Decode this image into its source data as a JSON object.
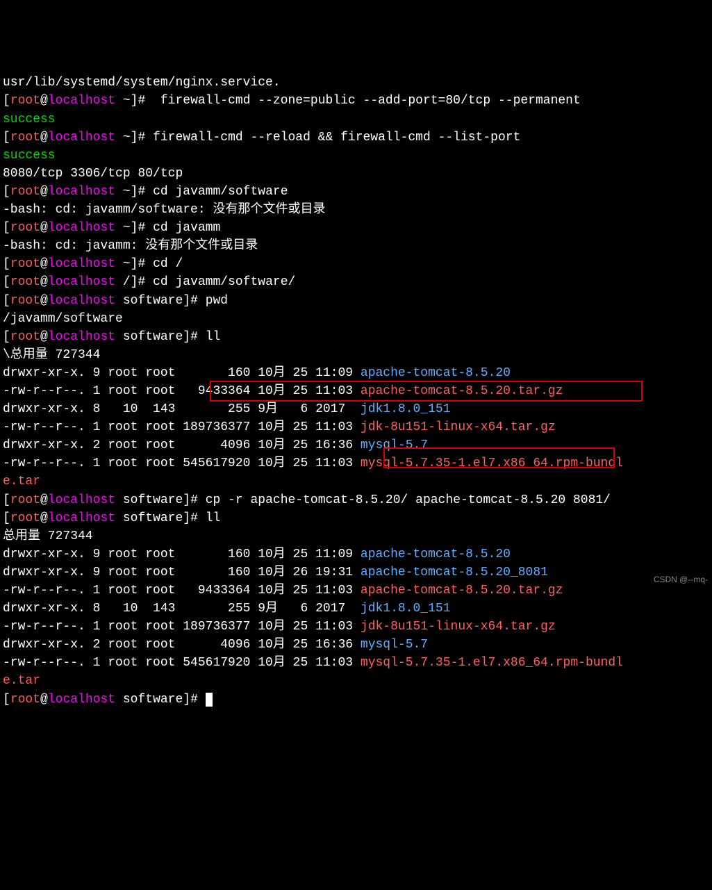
{
  "lines": [
    {
      "t": "usr/lib/systemd/system/nginx.service.",
      "c": "white"
    },
    {
      "prompt": true,
      "host": "localhost",
      "cwd": "~",
      "cmd": " firewall-cmd --zone=public --add-port=80/tcp --permanent"
    },
    {
      "t": "success",
      "c": "green"
    },
    {
      "prompt": true,
      "host": "localhost",
      "cwd": "~",
      "cmd": "firewall-cmd --reload && firewall-cmd --list-port"
    },
    {
      "t": "success",
      "c": "green"
    },
    {
      "t": "8080/tcp 3306/tcp 80/tcp",
      "c": "white"
    },
    {
      "prompt": true,
      "host": "localhost",
      "cwd": "~",
      "cmd": "cd javamm/software"
    },
    {
      "t": "-bash: cd: javamm/software: 没有那个文件或目录",
      "c": "white"
    },
    {
      "prompt": true,
      "host": "localhost",
      "cwd": "~",
      "cmd": "cd javamm"
    },
    {
      "t": "-bash: cd: javamm: 没有那个文件或目录",
      "c": "white"
    },
    {
      "prompt": true,
      "host": "localhost",
      "cwd": "~",
      "cmd": "cd /"
    },
    {
      "prompt": true,
      "host": "localhost",
      "cwd": "/",
      "cmd": "cd javamm/software/"
    },
    {
      "prompt": true,
      "host": "localhost",
      "cwd": "software",
      "cmd": "pwd"
    },
    {
      "t": "/javamm/software",
      "c": "white"
    },
    {
      "prompt": true,
      "host": "localhost",
      "cwd": "software",
      "cmd": "ll"
    },
    {
      "t": "\\总用量 727344",
      "c": "white"
    },
    {
      "ls": true,
      "perm": "drwxr-xr-x.",
      "n": "9",
      "o": "root",
      "g": "root",
      "size": "      160",
      "mon": "10月",
      "day": "25",
      "time": "11:09",
      "name": "apache-tomcat-8.5.20",
      "fc": "blue"
    },
    {
      "ls": true,
      "perm": "-rw-r--r--.",
      "n": "1",
      "o": "root",
      "g": "root",
      "size": "  9433364",
      "mon": "10月",
      "day": "25",
      "time": "11:03",
      "name": "apache-tomcat-8.5.20.tar.gz",
      "fc": "red"
    },
    {
      "ls": true,
      "perm": "drwxr-xr-x.",
      "n": "8",
      "o": "  10",
      "g": " 143",
      "size": "      255",
      "mon": "9月 ",
      "day": " 6",
      "time": "2017 ",
      "name": "jdk1.8.0_151",
      "fc": "blue"
    },
    {
      "ls": true,
      "perm": "-rw-r--r--.",
      "n": "1",
      "o": "root",
      "g": "root",
      "size": "189736377",
      "mon": "10月",
      "day": "25",
      "time": "11:03",
      "name": "jdk-8u151-linux-x64.tar.gz",
      "fc": "red"
    },
    {
      "ls": true,
      "perm": "drwxr-xr-x.",
      "n": "2",
      "o": "root",
      "g": "root",
      "size": "     4096",
      "mon": "10月",
      "day": "25",
      "time": "16:36",
      "name": "mysql-5.7",
      "fc": "blue"
    },
    {
      "ls": true,
      "perm": "-rw-r--r--.",
      "n": "1",
      "o": "root",
      "g": "root",
      "size": "545617920",
      "mon": "10月",
      "day": "25",
      "time": "11:03",
      "name": "mysql-5.7.35-1.el7.x86_64.rpm-bundl",
      "fc": "red",
      "wrap": "e.tar"
    },
    {
      "prompt": true,
      "host": "localhost",
      "cwd": "software",
      "cmd": "cp -r apache-tomcat-8.5.20/ apache-tomcat-8.5.20 8081/"
    },
    {
      "prompt": true,
      "host": "localhost",
      "cwd": "software",
      "cmd": "ll"
    },
    {
      "t": "总用量 727344",
      "c": "white"
    },
    {
      "ls": true,
      "perm": "drwxr-xr-x.",
      "n": "9",
      "o": "root",
      "g": "root",
      "size": "      160",
      "mon": "10月",
      "day": "25",
      "time": "11:09",
      "name": "apache-tomcat-8.5.20",
      "fc": "blue"
    },
    {
      "ls": true,
      "perm": "drwxr-xr-x.",
      "n": "9",
      "o": "root",
      "g": "root",
      "size": "      160",
      "mon": "10月",
      "day": "26",
      "time": "19:31",
      "name": "apache-tomcat-8.5.20_8081",
      "fc": "blue"
    },
    {
      "ls": true,
      "perm": "-rw-r--r--.",
      "n": "1",
      "o": "root",
      "g": "root",
      "size": "  9433364",
      "mon": "10月",
      "day": "25",
      "time": "11:03",
      "name": "apache-tomcat-8.5.20.tar.gz",
      "fc": "red"
    },
    {
      "ls": true,
      "perm": "drwxr-xr-x.",
      "n": "8",
      "o": "  10",
      "g": " 143",
      "size": "      255",
      "mon": "9月 ",
      "day": " 6",
      "time": "2017 ",
      "name": "jdk1.8.0_151",
      "fc": "blue"
    },
    {
      "ls": true,
      "perm": "-rw-r--r--.",
      "n": "1",
      "o": "root",
      "g": "root",
      "size": "189736377",
      "mon": "10月",
      "day": "25",
      "time": "11:03",
      "name": "jdk-8u151-linux-x64.tar.gz",
      "fc": "red"
    },
    {
      "ls": true,
      "perm": "drwxr-xr-x.",
      "n": "2",
      "o": "root",
      "g": "root",
      "size": "     4096",
      "mon": "10月",
      "day": "25",
      "time": "16:36",
      "name": "mysql-5.7",
      "fc": "blue"
    },
    {
      "ls": true,
      "perm": "-rw-r--r--.",
      "n": "1",
      "o": "root",
      "g": "root",
      "size": "545617920",
      "mon": "10月",
      "day": "25",
      "time": "11:03",
      "name": "mysql-5.7.35-1.el7.x86_64.rpm-bundl",
      "fc": "red",
      "wrap": "e.tar"
    },
    {
      "prompt": true,
      "host": "localhost",
      "cwd": "software",
      "cmd": "",
      "cursor": true
    }
  ],
  "prompt_parts": {
    "open": "[",
    "user": "root",
    "at": "@",
    "close": "]# "
  },
  "watermark": "CSDN @--mq-"
}
